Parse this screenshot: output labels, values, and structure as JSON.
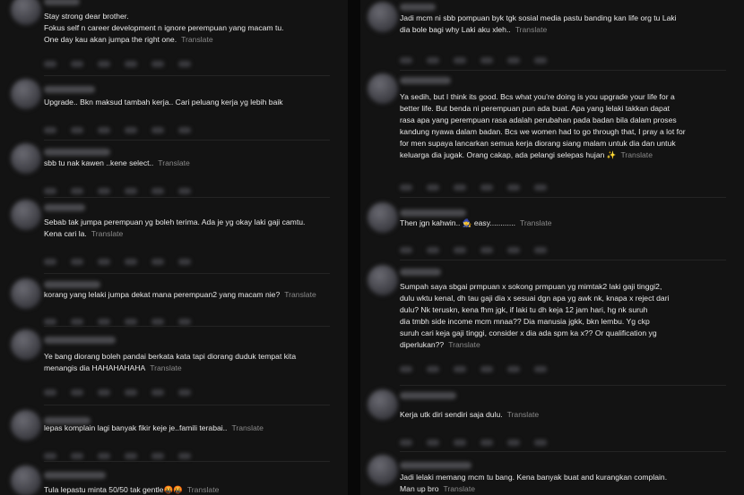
{
  "left": [
    {
      "text": "Stay strong dear brother.\nFokus self n career development n ignore perempuan yang macam tu.\nOne day kau akan jumpa the right one.",
      "translate": "Translate"
    },
    {
      "text": "Upgrade.. Bkn maksud tambah kerja.. Cari peluang kerja yg lebih baik",
      "translate": ""
    },
    {
      "text": "sbb tu nak kawen ..kene select..",
      "translate": "Translate"
    },
    {
      "text": "Sebab tak jumpa perempuan yg boleh terima. Ada je yg okay laki gaji camtu.\nKena cari la.",
      "translate": "Translate"
    },
    {
      "text": "korang yang lelaki jumpa dekat mana perempuan2 yang macam nie?",
      "translate": "Translate"
    },
    {
      "text": "Ye bang diorang boleh pandai berkata kata tapi diorang duduk tempat kita\nmenangis dia HAHAHAHAHA",
      "translate": "Translate"
    },
    {
      "text": "lepas komplain lagi banyak fikir keje je..famili terabai..",
      "translate": "Translate"
    },
    {
      "text": "Tula lepastu minta 50/50 tak gentle🤬🤬",
      "translate": "Translate"
    }
  ],
  "right": [
    {
      "text": "Jadi mcm ni sbb pompuan byk tgk sosial media pastu banding kan life org tu Laki\ndia bole bagi why Laki aku xleh..",
      "translate": "Translate"
    },
    {
      "text": "Ya sedih, but I think its good. Bcs what you're doing is you upgrade your life for a\nbetter life. But benda ni perempuan pun ada buat. Apa yang lelaki takkan dapat\nrasa apa yang perempuan rasa adalah perubahan pada badan bila dalam proses\nkandung nyawa dalam badan. Bcs we women had to go through that, I pray a lot for\nfor men supaya lancarkan semua kerja diorang siang malam untuk dia dan untuk\nkeluarga dia jugak. Orang cakap, ada pelangi selepas hujan ✨",
      "translate": "Translate"
    },
    {
      "text": "Then jgn kahwin.. 🧙 easy............",
      "translate": "Translate"
    },
    {
      "text": "Sumpah saya sbgai prmpuan x sokong prmpuan yg mimtak2 laki gaji tinggi2,\ndulu wktu kenal, dh tau gaji dia x sesuai dgn apa yg awk nk, knapa x reject dari\ndulu? Nk teruskn, kena fhm jgk, if laki tu dh keja 12 jam hari, hg nk suruh\ndia tmbh side income mcm mnaa?? Dia manusia jgkk, bkn lembu. Yg ckp\nsuruh cari keja gaji tinggi, consider x dia ada spm ka x?? Or qualification yg\ndiperlukan??",
      "translate": "Translate"
    },
    {
      "text": "Kerja utk diri sendiri saja dulu.",
      "translate": "Translate"
    },
    {
      "text": "Jadi lelaki memang mcm tu bang. Kena banyak buat and kurangkan complain.\nMan up bro",
      "translate": "Translate"
    }
  ]
}
